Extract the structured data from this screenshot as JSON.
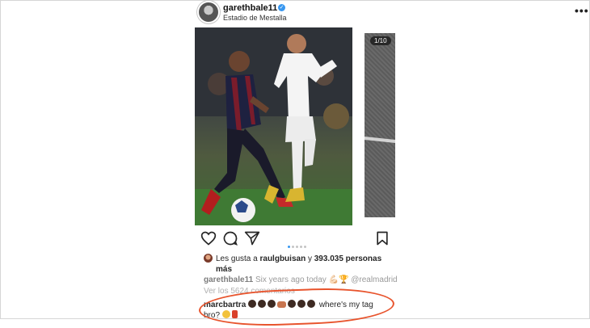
{
  "post": {
    "username": "garethbale11",
    "verified_icon": "verified-check-icon",
    "location": "Estadio de Mestalla",
    "more_icon": "more-options-icon",
    "carousel_counter": "1/10",
    "carousel": {
      "total_dots": 5,
      "active_index": 0
    }
  },
  "actions": {
    "icons": [
      "heart-icon",
      "comment-icon",
      "share-icon",
      "bookmark-icon"
    ]
  },
  "likes": {
    "prefix": "Les gusta a",
    "user": "raulgbuisan",
    "middle": "y",
    "count": "393.035 personas",
    "suffix": "más"
  },
  "caption": {
    "username": "garethbale11",
    "text": "Six years ago today 💪🏻🏆 @realmadrid"
  },
  "comments_link": "Ver los 5624 comentarios",
  "comment": {
    "username": "marcbartra",
    "text_tail": "where's my tag",
    "text_line2": "bro?"
  },
  "colors": {
    "verified": "#3897f0",
    "highlight": "#e8542d"
  }
}
